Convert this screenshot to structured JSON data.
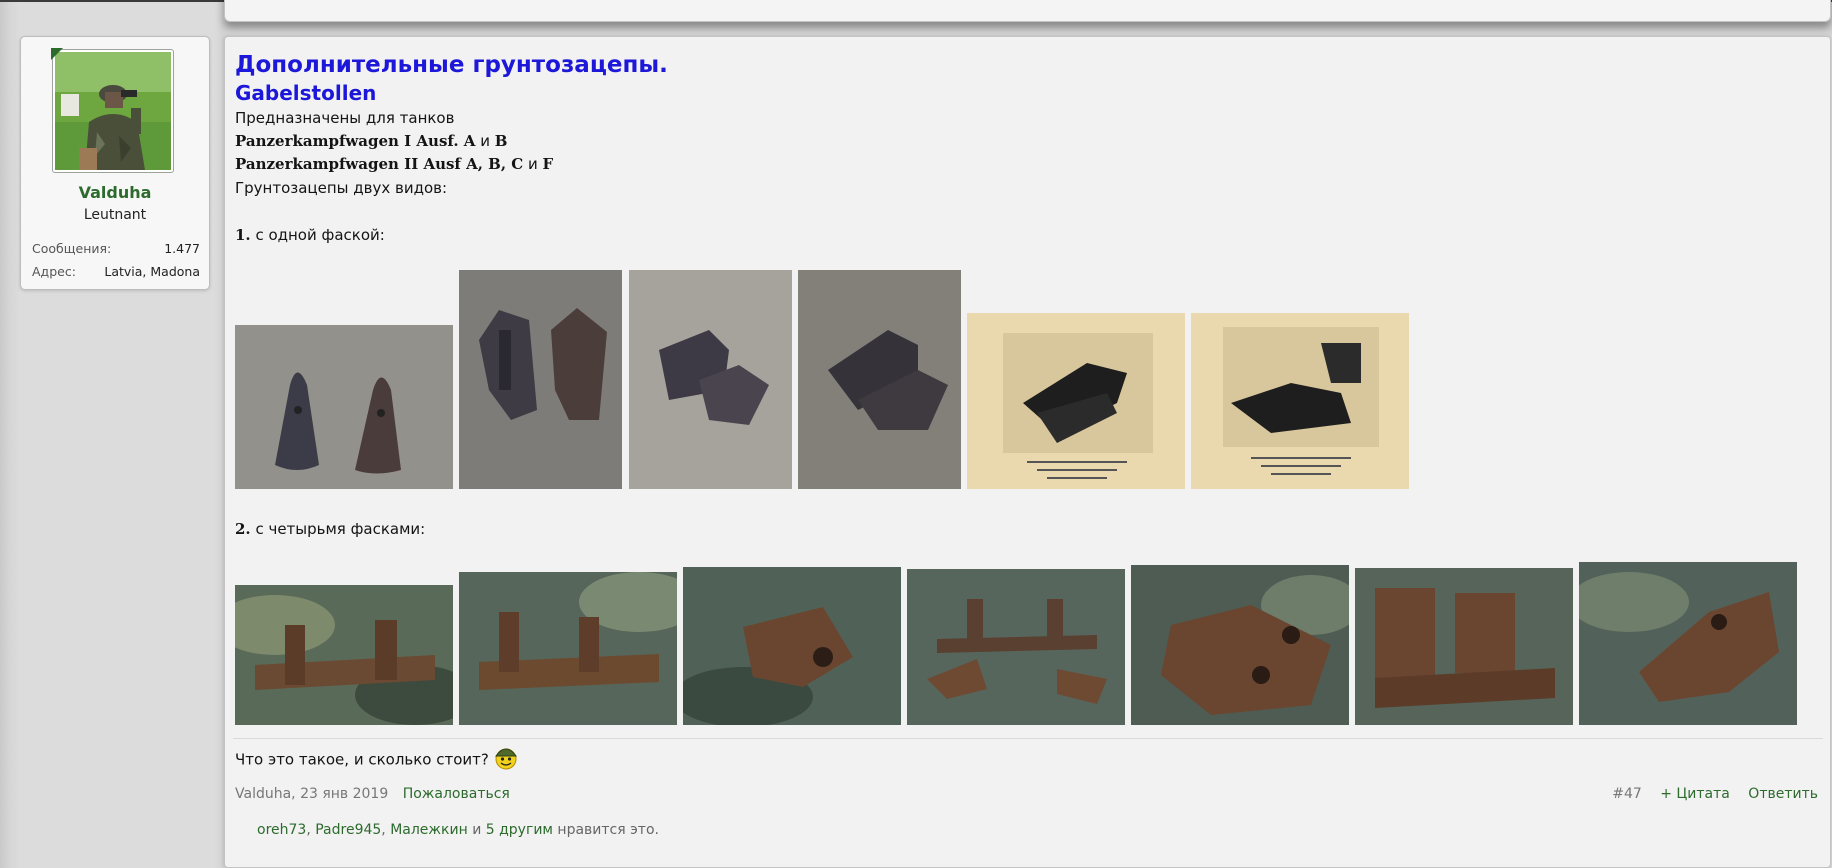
{
  "user": {
    "name": "Valduha",
    "rank": "Leutnant",
    "stats": [
      {
        "label": "Сообщения:",
        "value": "1.477"
      },
      {
        "label": "Адрес:",
        "value": "Latvia, Madona"
      }
    ]
  },
  "post": {
    "title": "Дополнительные грунтозацепы.",
    "subtitle": "Gabelstollen",
    "line1": "Предназначены для танков",
    "tank1_name": "Panzerkampfwagen I Ausf. A",
    "tank1_and": " и ",
    "tank1_tail": "B",
    "tank2_name": "Panzerkampfwagen II Ausf A, B, C",
    "tank2_and": " и ",
    "tank2_tail": "F",
    "line4": "Грунтозацепы двух видов:",
    "section1_num": "1.",
    "section1_text": " с одной фаской:",
    "section2_num": "2.",
    "section2_text": " с четырьмя фасками:",
    "question": "Что это такое, и сколько стоит?",
    "smiley_icon": "soldier-smiley-icon"
  },
  "meta": {
    "author": "Valduha",
    "date": ", 23 янв 2019",
    "report": "Пожаловаться",
    "post_number": "#47",
    "quote": "+ Цитата",
    "reply": "Ответить"
  },
  "likes": {
    "user1": "oreh73",
    "user2": "Padre945",
    "user3": "Малежкин",
    "and_word": " и ",
    "others": "5 другим",
    "tail": " нравится это."
  },
  "colors": {
    "title_blue": "#1c17d9",
    "link_green": "#2d6b2d"
  }
}
